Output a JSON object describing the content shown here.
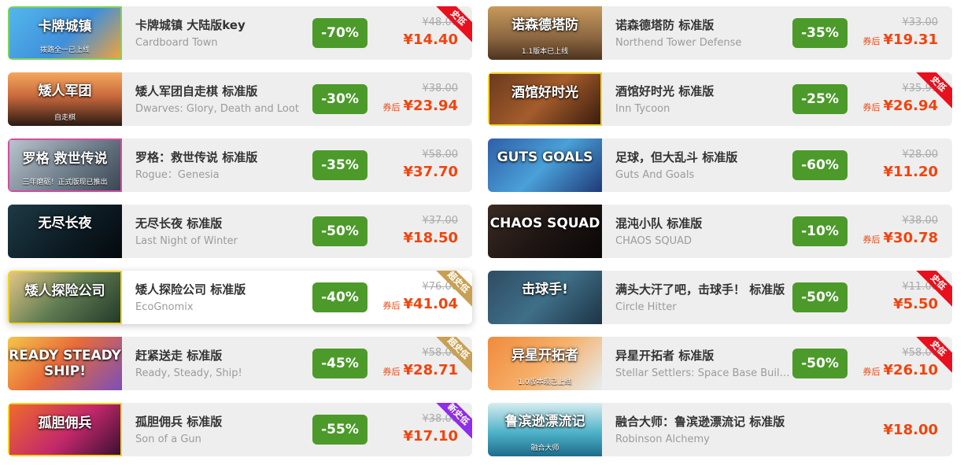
{
  "colors": {
    "discount_green": "#4c9a2a",
    "price_orange": "#f0440e",
    "badge_red": "#e8101d",
    "badge_gold": "#c8a054",
    "badge_purple": "#8e2ee8"
  },
  "games": [
    {
      "title": "卡牌城镇 大陆版key",
      "subtitle": "Cardboard Town",
      "discount": "-70%",
      "original": "¥48.00",
      "price": "¥14.40",
      "coupon": "",
      "badge": "史低",
      "badge_color": "#e8101d",
      "thumb_text": "卡牌城镇",
      "thumb_sub": "拨路全一已上线",
      "thumb_bg": "linear-gradient(135deg,#53b7ea 0%,#3f8fdc 55%,#f1a33b 100%)",
      "thumb_border": "#7dd35a"
    },
    {
      "title": "诺森德塔防 标准版",
      "subtitle": "Northend Tower Defense",
      "discount": "-35%",
      "original": "¥33.00",
      "price": "¥19.31",
      "coupon": "券后",
      "badge": "",
      "badge_color": "",
      "thumb_text": "诺森德塔防",
      "thumb_sub": "1.1版本已上线",
      "thumb_bg": "linear-gradient(180deg,#c79a5d 0%,#8a6540 60%,#4c3420 100%)",
      "thumb_border": ""
    },
    {
      "title": "矮人军团自走棋 标准版",
      "subtitle": "Dwarves: Glory, Death and Loot",
      "discount": "-30%",
      "original": "¥38.00",
      "price": "¥23.94",
      "coupon": "券后",
      "badge": "",
      "badge_color": "",
      "thumb_text": "矮人军团",
      "thumb_sub": "自走棋",
      "thumb_bg": "linear-gradient(180deg,#f3a85e 0%,#c9683c 45%,#2a1a14 100%)",
      "thumb_border": ""
    },
    {
      "title": "酒馆好时光 标准版",
      "subtitle": "Inn Tycoon",
      "discount": "-25%",
      "original": "¥35.99",
      "price": "¥26.94",
      "coupon": "券后",
      "badge": "史低",
      "badge_color": "#e8101d",
      "thumb_text": "酒馆好时光",
      "thumb_sub": "",
      "thumb_bg": "linear-gradient(135deg,#6b3a1e 0%,#a45c2c 50%,#3a1c0e 100%)",
      "thumb_border": "#f0d21f"
    },
    {
      "title": "罗格：救世传说 标准版",
      "subtitle": "Rogue：Genesia",
      "discount": "-35%",
      "original": "¥58.00",
      "price": "¥37.70",
      "coupon": "",
      "badge": "",
      "badge_color": "",
      "thumb_text": "罗格 救世传说",
      "thumb_sub": "三年磨砺！正式版现已推出",
      "thumb_bg": "linear-gradient(135deg,#b9c3cc 0%,#6f7f8c 55%,#3b4652 100%)",
      "thumb_border": "#d64ca0"
    },
    {
      "title": "足球，但大乱斗 标准版",
      "subtitle": "Guts And Goals",
      "discount": "-60%",
      "original": "¥28.00",
      "price": "¥11.20",
      "coupon": "",
      "badge": "",
      "badge_color": "",
      "thumb_text": "GUTS GOALS",
      "thumb_sub": "",
      "thumb_bg": "linear-gradient(135deg,#2f5ea8 0%,#4aa0d8 50%,#1f3a78 100%)",
      "thumb_border": ""
    },
    {
      "title": "无尽长夜 标准版",
      "subtitle": "Last Night of Winter",
      "discount": "-50%",
      "original": "¥37.00",
      "price": "¥18.50",
      "coupon": "",
      "badge": "",
      "badge_color": "",
      "thumb_text": "无尽长夜",
      "thumb_sub": "",
      "thumb_bg": "linear-gradient(135deg,#1d3a45 0%,#0c1a22 60%,#05090c 100%)",
      "thumb_border": ""
    },
    {
      "title": "混沌小队 标准版",
      "subtitle": "CHAOS SQUAD",
      "discount": "-10%",
      "original": "¥38.00",
      "price": "¥30.78",
      "coupon": "券后",
      "badge": "",
      "badge_color": "",
      "thumb_text": "CHAOS SQUAD",
      "thumb_sub": "",
      "thumb_bg": "linear-gradient(135deg,#3a2a22 0%,#1c1412 55%,#0a0707 100%)",
      "thumb_border": ""
    },
    {
      "title": "矮人探险公司 标准版",
      "subtitle": "EcoGnomix",
      "discount": "-40%",
      "original": "¥76.00",
      "price": "¥41.04",
      "coupon": "券后",
      "badge": "超史低",
      "badge_color": "#c8a054",
      "thumb_text": "矮人探险公司",
      "thumb_sub": "",
      "thumb_bg": "linear-gradient(135deg,#e2c585 0%,#5f7b52 50%,#233a2a 100%)",
      "thumb_border": "#f0d21f"
    },
    {
      "title": "满头大汗了吧，击球手！ 标准版",
      "subtitle": "Circle Hitter",
      "discount": "-50%",
      "original": "¥11.00",
      "price": "¥5.50",
      "coupon": "",
      "badge": "史低",
      "badge_color": "#e8101d",
      "thumb_text": "击球手!",
      "thumb_sub": "",
      "thumb_bg": "linear-gradient(135deg,#2e4c62 0%,#3f6f88 50%,#1d3445 100%)",
      "thumb_border": ""
    },
    {
      "title": "赶紧送走 标准版",
      "subtitle": "Ready, Steady, Ship!",
      "discount": "-45%",
      "original": "¥58.00",
      "price": "¥28.71",
      "coupon": "券后",
      "badge": "超史低",
      "badge_color": "#c8a054",
      "thumb_text": "READY STEADY SHIP!",
      "thumb_sub": "",
      "thumb_bg": "linear-gradient(135deg,#f4c64a 0%,#e86b3a 45%,#7a4fb8 100%)",
      "thumb_border": ""
    },
    {
      "title": "异星开拓者 标准版",
      "subtitle": "Stellar Settlers: Space Base Builder",
      "discount": "-50%",
      "original": "¥58.00",
      "price": "¥26.10",
      "coupon": "券后",
      "badge": "史低",
      "badge_color": "#e8101d",
      "thumb_text": "异星开拓者",
      "thumb_sub": "1.0版本现已上线",
      "thumb_bg": "linear-gradient(135deg,#f08a3c 0%,#f6b06a 50%,#e5eef2 100%)",
      "thumb_border": ""
    },
    {
      "title": "孤胆佣兵 标准版",
      "subtitle": "Son of a Gun",
      "discount": "-55%",
      "original": "¥38.00",
      "price": "¥17.10",
      "coupon": "",
      "badge": "新史低",
      "badge_color": "#8e2ee8",
      "thumb_text": "孤胆佣兵",
      "thumb_sub": "",
      "thumb_bg": "linear-gradient(135deg,#f06a2a 0%,#c2286a 55%,#3a1034 100%)",
      "thumb_border": "#f0d21f"
    },
    {
      "title": "融合大师：鲁滨逊漂流记 标准版",
      "subtitle": "Robinson Alchemy",
      "discount": "",
      "original": "",
      "price": "¥18.00",
      "coupon": "",
      "badge": "",
      "badge_color": "",
      "thumb_text": "鲁滨逊漂流记",
      "thumb_sub": "融合大师",
      "thumb_bg": "linear-gradient(180deg,#d7ecf0 0%,#4fb3c9 55%,#1e6c8a 100%)",
      "thumb_border": ""
    }
  ]
}
